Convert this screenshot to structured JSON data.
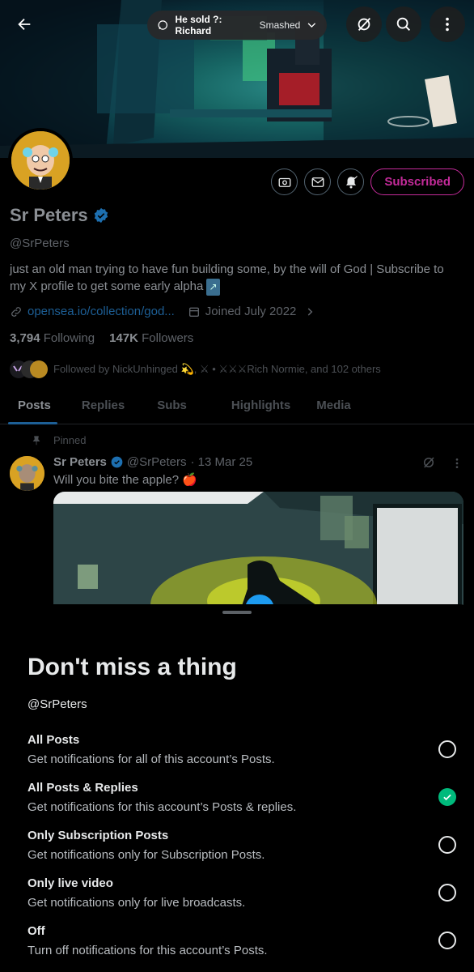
{
  "space": {
    "title": "He sold ?: Richard",
    "subtitle": "Smashed"
  },
  "profile": {
    "name": "Sr Peters",
    "handle": "@SrPeters",
    "bio": "just an old man trying to have fun building some, by the will of God | Subscribe to my X profile to get some early alpha",
    "bio_emoji": "↗",
    "link": "opensea.io/collection/god...",
    "joined": "Joined July 2022",
    "following_count": "3,794",
    "following_label": "Following",
    "followers_count": "147K",
    "followers_label": "Followers",
    "followed_by": "Followed by NickUnhinged 💫, ⚔ • ⚔⚔⚔Rich Normie, and 102 others",
    "subscribed_label": "Subscribed"
  },
  "tabs": [
    "Posts",
    "Replies",
    "Subs",
    "Highlights",
    "Media"
  ],
  "pinned_post": {
    "pinned_label": "Pinned",
    "author": "Sr Peters",
    "handle": "@SrPeters",
    "date": "· 13 Mar 25",
    "text": "Will you bite the apple? 🍎"
  },
  "sheet": {
    "title": "Don't miss a thing",
    "handle": "@SrPeters",
    "options": [
      {
        "title": "All Posts",
        "desc": "Get notifications for all of this account’s Posts.",
        "selected": false
      },
      {
        "title": "All Posts & Replies",
        "desc": "Get notifications for this account’s Posts & replies.",
        "selected": true
      },
      {
        "title": "Only Subscription Posts",
        "desc": "Get notifications only for Subscription Posts.",
        "selected": false
      },
      {
        "title": "Only live video",
        "desc": "Get notifications only for live broadcasts.",
        "selected": false
      },
      {
        "title": "Off",
        "desc": "Turn off notifications for this account’s Posts.",
        "selected": false
      }
    ]
  },
  "colors": {
    "accent": "#1d9bf0",
    "subscribed": "#c42b9a",
    "selected": "#00ba7c"
  }
}
